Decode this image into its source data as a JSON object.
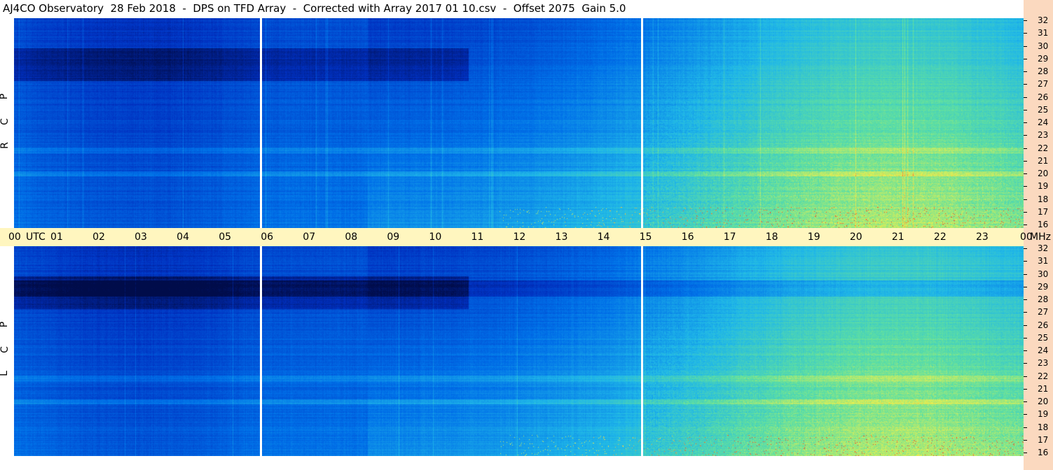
{
  "title": "AJ4CO Observatory  28 Feb 2018  -  DPS on TFD Array  -  Corrected with Array 2017 01 10.csv  -  Offset 2075  Gain 5.0",
  "chart_data": {
    "type": "heatmap",
    "title": "AJ4CO Observatory  28 Feb 2018  -  DPS on TFD Array  -  Corrected with Array 2017 01 10.csv  -  Offset 2075  Gain 5.0",
    "x_unit_label": "UTC",
    "y_unit_label": "MHz",
    "x_ticks": [
      "00",
      "01",
      "02",
      "03",
      "04",
      "05",
      "06",
      "07",
      "08",
      "09",
      "10",
      "11",
      "12",
      "13",
      "14",
      "15",
      "16",
      "17",
      "18",
      "19",
      "20",
      "21",
      "22",
      "23",
      "00"
    ],
    "x_range_hours": [
      0,
      24
    ],
    "y_ticks": [
      "32",
      "31",
      "30",
      "29",
      "28",
      "27",
      "26",
      "25",
      "24",
      "23",
      "22",
      "21",
      "20",
      "19",
      "18",
      "17",
      "16"
    ],
    "y_range_mhz": [
      16,
      32
    ],
    "panels": [
      {
        "name": "R C P",
        "letters": [
          "P",
          "C",
          "R"
        ]
      },
      {
        "name": "L C P",
        "letters": [
          "P",
          "C",
          "L"
        ]
      }
    ],
    "data_gaps_utc": [
      "05:52",
      "14:55"
    ],
    "colormap": [
      "#000c4a",
      "#0030c0",
      "#0070e8",
      "#20b8e8",
      "#60e0a0",
      "#e8f050",
      "#ff4020"
    ]
  },
  "labels": {
    "utc": "UTC",
    "mhz": "MHz"
  }
}
